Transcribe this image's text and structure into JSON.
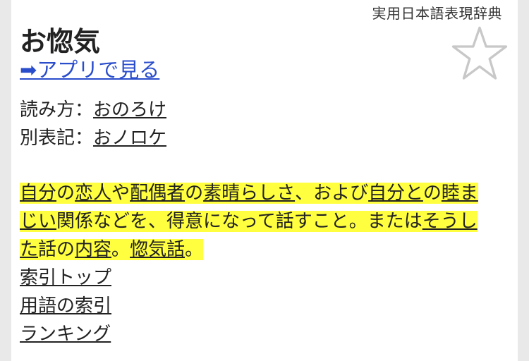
{
  "header": {
    "source": "実用日本語表現辞典",
    "title": "お惚気",
    "app_link": "➡アプリで見る"
  },
  "meta": {
    "reading_label": "読み方：",
    "reading_value": "おのろけ",
    "alt_label": "別表記：",
    "alt_value": "おノロケ"
  },
  "definition": {
    "parts": [
      {
        "text": "自分",
        "link": true
      },
      {
        "text": "の",
        "link": false
      },
      {
        "text": "恋人",
        "link": true
      },
      {
        "text": "や",
        "link": false
      },
      {
        "text": "配偶者",
        "link": true
      },
      {
        "text": "の",
        "link": false
      },
      {
        "text": "素晴らしさ",
        "link": true
      },
      {
        "text": "、および",
        "link": false
      },
      {
        "text": "自分と",
        "link": true
      },
      {
        "text": "の",
        "link": false
      },
      {
        "text": "睦まじい",
        "link": true
      },
      {
        "text": "関係などを、得意になって話すこと。または",
        "link": false
      },
      {
        "text": "そうした",
        "link": true
      },
      {
        "text": "話の",
        "link": false
      },
      {
        "text": "内容",
        "link": true
      },
      {
        "text": "。",
        "link": false
      },
      {
        "text": "惚気話",
        "link": true
      },
      {
        "text": "。",
        "link": false
      }
    ]
  },
  "links": {
    "index_top": "索引トップ",
    "term_index": "用語の索引",
    "ranking": "ランキング"
  },
  "colors": {
    "highlight": "#ffff40",
    "link_blue": "#2a4dcc"
  }
}
